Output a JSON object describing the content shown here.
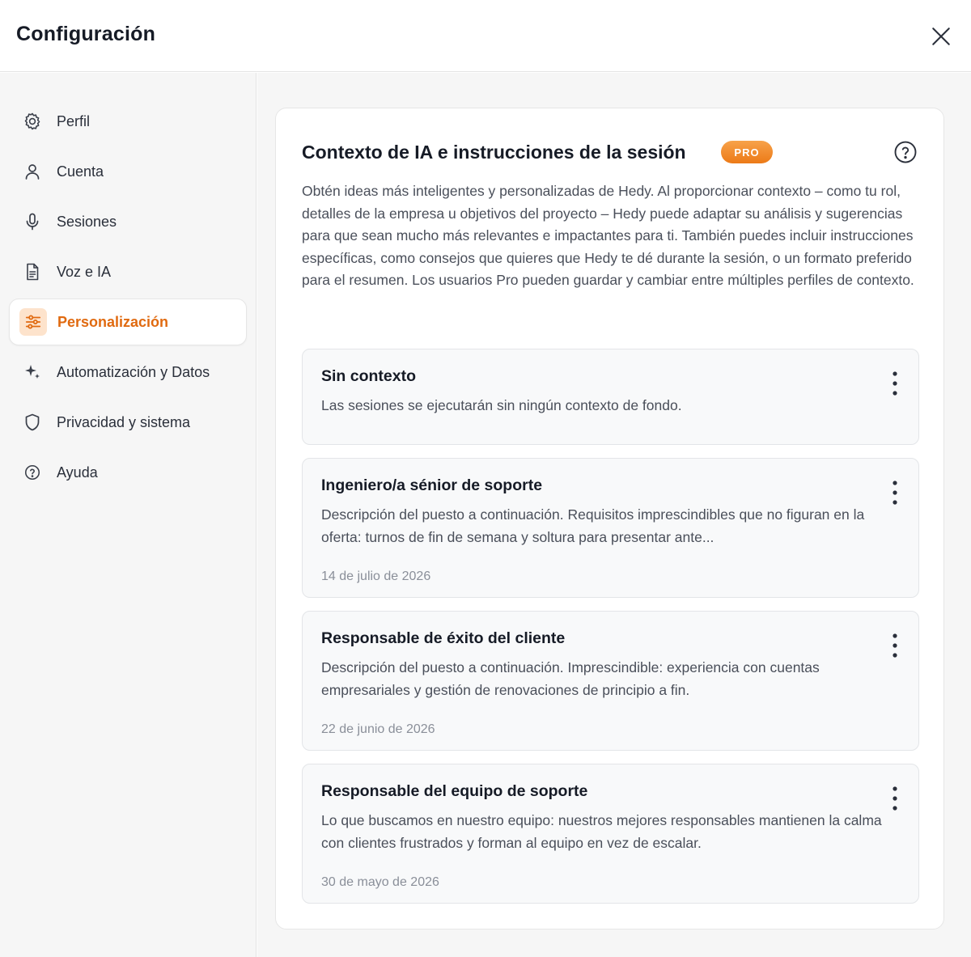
{
  "header": {
    "title": "Configuración",
    "close_icon": "close-icon"
  },
  "sidebar": {
    "items": [
      {
        "label": "Perfil",
        "icon": "gear-icon"
      },
      {
        "label": "Cuenta",
        "icon": "user-icon"
      },
      {
        "label": "Sesiones",
        "icon": "microphone-icon"
      },
      {
        "label": "Voz e IA",
        "icon": "document-icon"
      },
      {
        "label": "Personalización",
        "icon": "sliders-icon",
        "active": true
      },
      {
        "label": "Automatización y Datos",
        "icon": "sparkle-icon"
      },
      {
        "label": "Privacidad y sistema",
        "icon": "shield-icon"
      },
      {
        "label": "Ayuda",
        "icon": "help-circle-icon"
      }
    ]
  },
  "main": {
    "title": "Contexto de IA e instrucciones de la sesión",
    "badge": "PRO",
    "help_icon": "help-circle-icon",
    "description": "Obtén ideas más inteligentes y personalizadas de Hedy. Al proporcionar contexto – como tu rol, detalles de la empresa u objetivos del proyecto – Hedy puede adaptar su análisis y sugerencias para que sean mucho más relevantes e impactantes para ti. También puedes incluir instrucciones específicas, como consejos que quieres que Hedy te dé durante la sesión, o un formato preferido para el resumen. Los usuarios Pro pueden guardar y cambiar entre múltiples perfiles de contexto.",
    "contexts": [
      {
        "title": "Sin contexto",
        "description": "Las sesiones se ejecutarán sin ningún contexto de fondo.",
        "date": ""
      },
      {
        "title": "Ingeniero/a sénior de soporte",
        "description": "Descripción del puesto a continuación. Requisitos imprescindibles que no figuran en la oferta: turnos de fin de semana y soltura para presentar ante...",
        "date": "14 de julio de 2026"
      },
      {
        "title": "Responsable de éxito del cliente",
        "description": "Descripción del puesto a continuación. Imprescindible: experiencia con cuentas empresariales y gestión de renovaciones de principio a fin.",
        "date": "22 de junio de 2026"
      },
      {
        "title": "Responsable del equipo de soporte",
        "description": "Lo que buscamos en nuestro equipo: nuestros mejores responsables mantienen la calma con clientes frustrados y forman al equipo en vez de escalar.",
        "date": "30 de mayo de 2026"
      }
    ]
  },
  "colors": {
    "accent": "#e06a10",
    "accent_bg": "#fde3cc",
    "badge": "#ec7a17"
  }
}
